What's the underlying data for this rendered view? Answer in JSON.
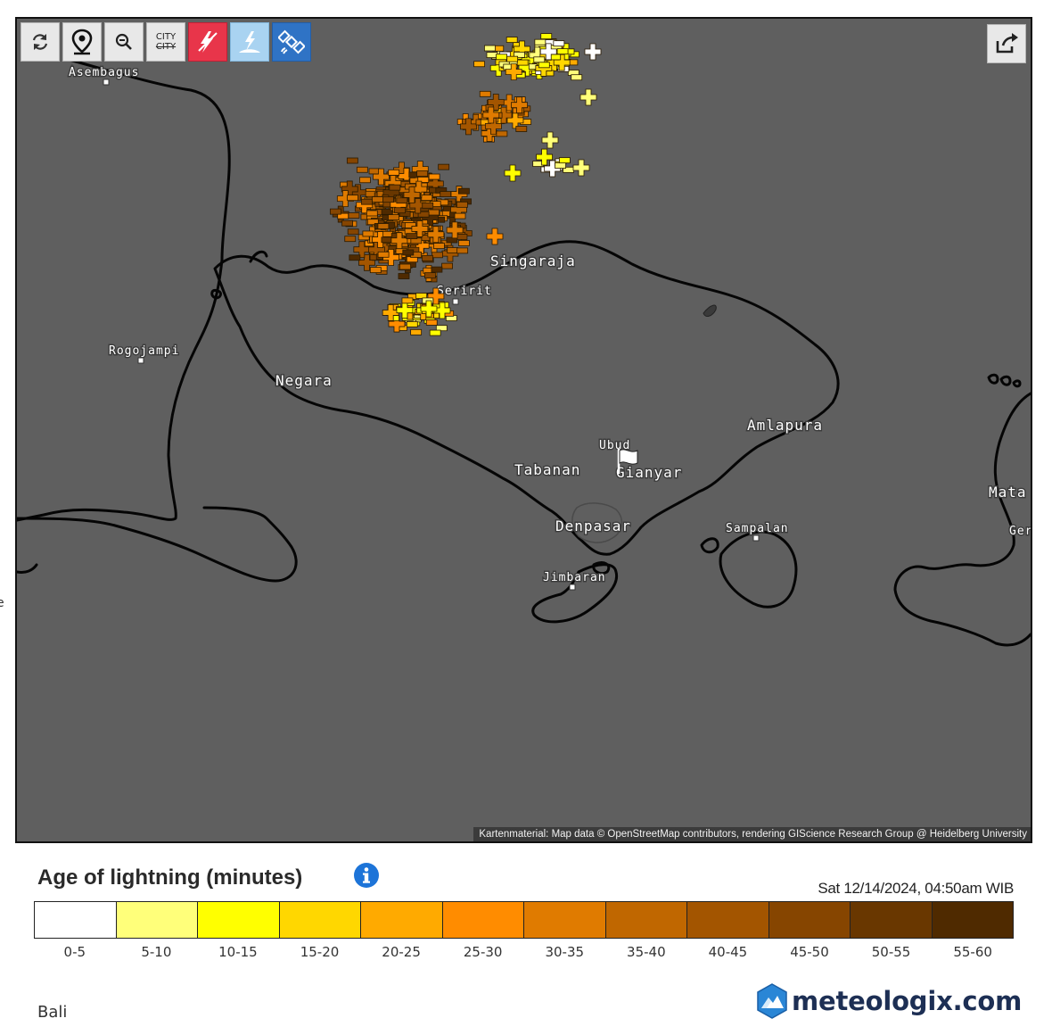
{
  "side_text": "e",
  "toolbar": {
    "buttons": [
      {
        "name": "refresh",
        "icon": "refresh-icon"
      },
      {
        "name": "my-location",
        "icon": "location-pin-icon"
      },
      {
        "name": "zoom-out",
        "icon": "zoom-out-icon"
      },
      {
        "name": "toggle-city-labels",
        "icon": "city-label-icon",
        "label_top": "CITY",
        "label_bottom": "CITY"
      },
      {
        "name": "lightning-layer",
        "icon": "lightning-icon",
        "color": "#e8354a"
      },
      {
        "name": "lightning-ground-layer",
        "icon": "lightning-strike-icon",
        "color": "#a9d3f1"
      },
      {
        "name": "satellite-layer",
        "icon": "satellite-icon",
        "color": "#2f73c5"
      }
    ],
    "share_icon": "share-icon"
  },
  "map": {
    "background": "#5f5f5f",
    "coast_color": "#050505",
    "places": [
      {
        "name": "Asembagus",
        "type": "town"
      },
      {
        "name": "Singaraja",
        "type": "city"
      },
      {
        "name": "Seririt",
        "type": "town"
      },
      {
        "name": "Rogojampi",
        "type": "town"
      },
      {
        "name": "Negara",
        "type": "city"
      },
      {
        "name": "Amlapura",
        "type": "city"
      },
      {
        "name": "Ubud",
        "type": "town"
      },
      {
        "name": "Tabanan",
        "type": "city"
      },
      {
        "name": "Gianyar",
        "type": "city"
      },
      {
        "name": "Mata",
        "type": "city"
      },
      {
        "name": "Ger",
        "type": "town"
      },
      {
        "name": "Denpasar",
        "type": "city"
      },
      {
        "name": "Sampalan",
        "type": "town"
      },
      {
        "name": "Jimbaran",
        "type": "town"
      }
    ],
    "attribution": "Kartenmaterial: Map data © OpenStreetMap contributors, rendering GIScience Research Group @ Heidelberg University",
    "marker_icon": "flag-icon"
  },
  "legend": {
    "title": "Age of lightning (minutes)",
    "info_icon": "info-icon",
    "timestamp": "Sat 12/14/2024, 04:50am WIB",
    "bins": [
      {
        "label": "0-5",
        "color": "#ffffff"
      },
      {
        "label": "5-10",
        "color": "#ffff7a"
      },
      {
        "label": "10-15",
        "color": "#ffff00"
      },
      {
        "label": "15-20",
        "color": "#ffd700"
      },
      {
        "label": "20-25",
        "color": "#ffaa00"
      },
      {
        "label": "25-30",
        "color": "#ff8c00"
      },
      {
        "label": "30-35",
        "color": "#e07b00"
      },
      {
        "label": "35-40",
        "color": "#c06700"
      },
      {
        "label": "40-45",
        "color": "#a35500"
      },
      {
        "label": "45-50",
        "color": "#864500"
      },
      {
        "label": "50-55",
        "color": "#693700"
      },
      {
        "label": "55-60",
        "color": "#4f2a00"
      }
    ]
  },
  "location": "Bali",
  "brand": {
    "text": "meteologix.com",
    "icon": "meteologix-logo-icon"
  }
}
